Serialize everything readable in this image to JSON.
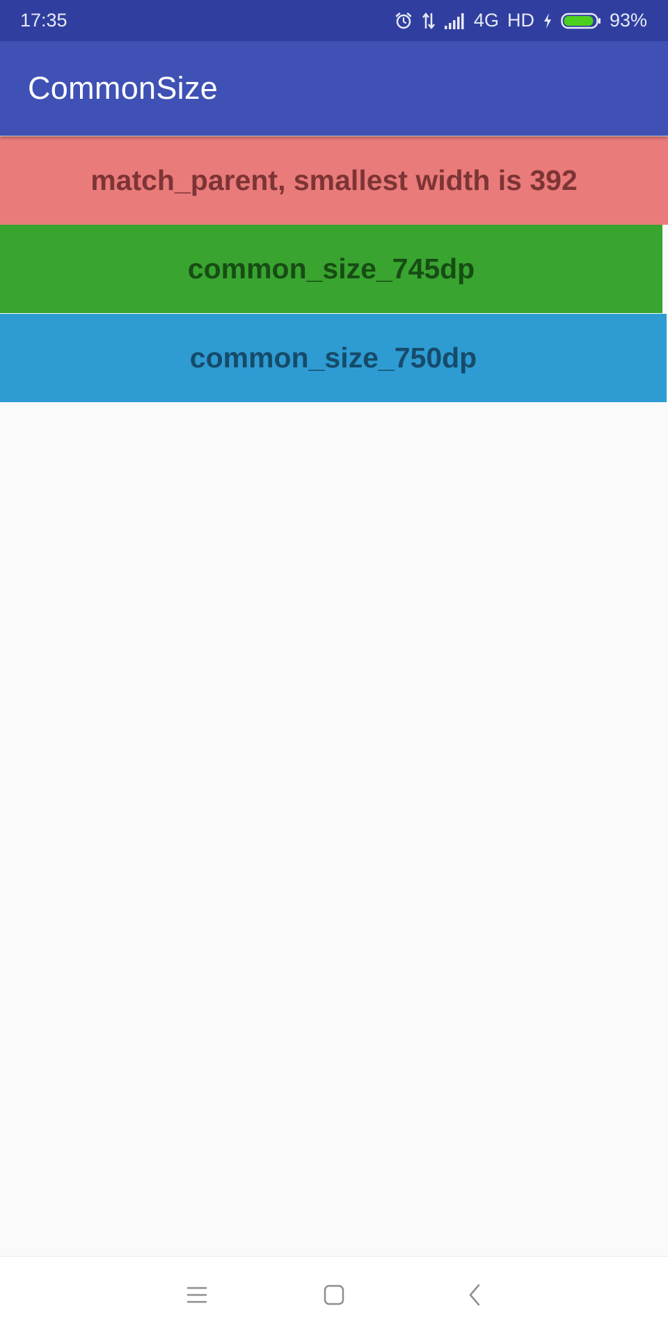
{
  "status_bar": {
    "time": "17:35",
    "network": "4G",
    "hd": "HD",
    "battery_percent": "93%",
    "battery_level": 0.93,
    "icons": [
      "alarm-icon",
      "data-transfer-icon",
      "signal-icon",
      "charging-icon",
      "battery-icon"
    ]
  },
  "app_bar": {
    "title": "CommonSize"
  },
  "bars": [
    {
      "label": "match_parent, smallest width is 392",
      "color": "#ea7b7b",
      "text_color": "#7d3435"
    },
    {
      "label": "common_size_745dp",
      "color": "#39a42f",
      "text_color": "#174d14"
    },
    {
      "label": "common_size_750dp",
      "color": "#2e9cd3",
      "text_color": "#154b6a"
    }
  ],
  "nav_bar": {
    "buttons": [
      "menu-icon",
      "home-icon",
      "back-icon"
    ]
  },
  "colors": {
    "status_bar": "#303f9f",
    "app_bar": "#3f51b5",
    "background": "#fafafa"
  }
}
